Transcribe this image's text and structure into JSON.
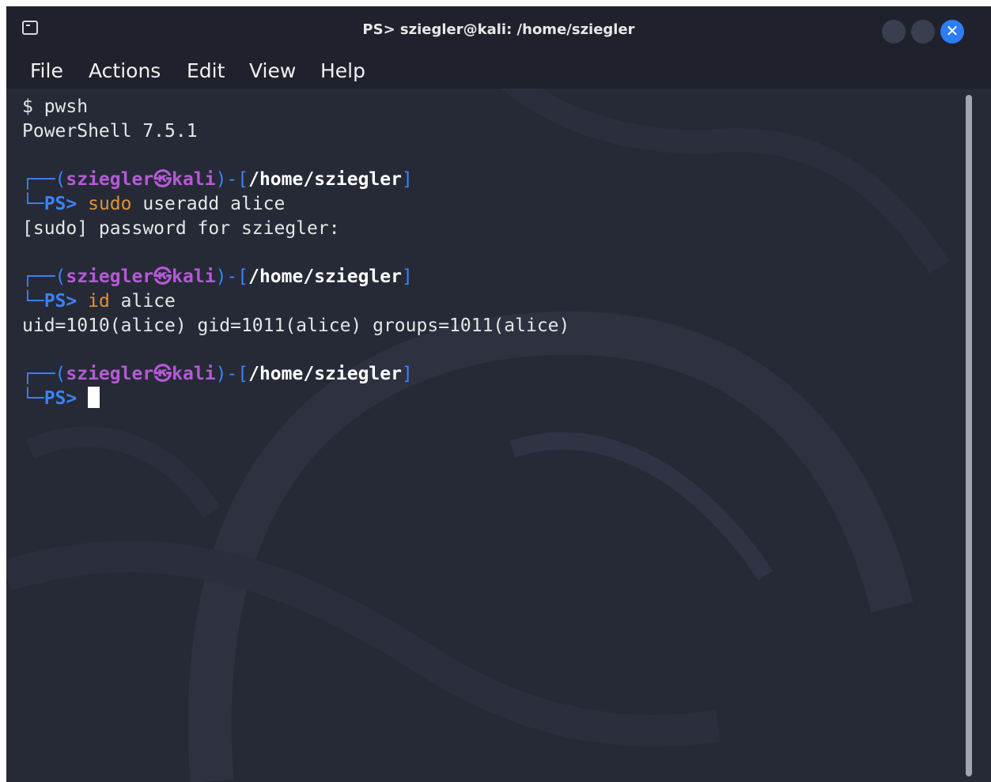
{
  "window": {
    "title": "PS> sziegler@kali: /home/sziegler",
    "close_glyph": "✕",
    "accent_color": "#2e7cf6"
  },
  "menu": [
    "File",
    "Actions",
    "Edit",
    "View",
    "Help"
  ],
  "terminal": {
    "line1": "$ pwsh",
    "line2": "PowerShell 7.5.1",
    "prompt_user": "sziegler",
    "prompt_at": "㉿",
    "prompt_host": "kali",
    "prompt_path": "/home/sziegler",
    "ps_label": "PS>",
    "corner_top": "┌──(",
    "corner_mid": ")-[",
    "corner_end": "]",
    "corner_bottom": "└─",
    "cmd1_keyword": "sudo",
    "cmd1_rest": " useradd alice",
    "out1": "[sudo] password for sziegler:",
    "cmd2_keyword": "id",
    "cmd2_rest": " alice",
    "out2": "uid=1010(alice) gid=1011(alice) groups=1011(alice)"
  },
  "colors": {
    "background": "#262a37",
    "prompt_blue": "#3b82f6",
    "prompt_purple": "#b55ad6",
    "command_orange": "#e0913b"
  }
}
